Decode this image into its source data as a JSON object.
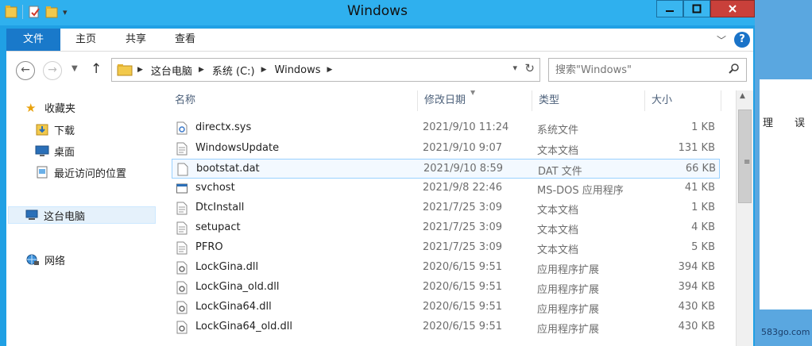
{
  "window": {
    "title": "Windows"
  },
  "ribbon": {
    "tabs": [
      "文件",
      "主页",
      "共享",
      "查看"
    ],
    "help_label": "?"
  },
  "address": {
    "crumbs": [
      "这台电脑",
      "系统 (C:)",
      "Windows"
    ]
  },
  "search": {
    "placeholder": "搜索\"Windows\""
  },
  "sidebar": {
    "items": [
      {
        "label": "收藏夹",
        "icon": "star-icon"
      },
      {
        "label": "下载",
        "icon": "download-folder-icon"
      },
      {
        "label": "桌面",
        "icon": "desktop-icon"
      },
      {
        "label": "最近访问的位置",
        "icon": "recent-places-icon"
      },
      {
        "label": "这台电脑",
        "icon": "computer-icon"
      },
      {
        "label": "网络",
        "icon": "network-icon"
      }
    ]
  },
  "columns": [
    "名称",
    "修改日期",
    "类型",
    "大小"
  ],
  "files": [
    {
      "name": "directx.sys",
      "date": "2021/9/10 11:24",
      "type": "系统文件",
      "size": "1 KB",
      "icon": "system-file-icon"
    },
    {
      "name": "WindowsUpdate",
      "date": "2021/9/10 9:07",
      "type": "文本文档",
      "size": "131 KB",
      "icon": "text-file-icon"
    },
    {
      "name": "bootstat.dat",
      "date": "2021/9/10 8:59",
      "type": "DAT 文件",
      "size": "66 KB",
      "icon": "blank-file-icon"
    },
    {
      "name": "svchost",
      "date": "2021/9/8 22:46",
      "type": "MS-DOS 应用程序",
      "size": "41 KB",
      "icon": "msdos-app-icon"
    },
    {
      "name": "DtcInstall",
      "date": "2021/7/25 3:09",
      "type": "文本文档",
      "size": "1 KB",
      "icon": "text-file-icon"
    },
    {
      "name": "setupact",
      "date": "2021/7/25 3:09",
      "type": "文本文档",
      "size": "4 KB",
      "icon": "text-file-icon"
    },
    {
      "name": "PFRO",
      "date": "2021/7/25 3:09",
      "type": "文本文档",
      "size": "5 KB",
      "icon": "text-file-icon"
    },
    {
      "name": "LockGina.dll",
      "date": "2020/6/15 9:51",
      "type": "应用程序扩展",
      "size": "394 KB",
      "icon": "dll-file-icon"
    },
    {
      "name": "LockGina_old.dll",
      "date": "2020/6/15 9:51",
      "type": "应用程序扩展",
      "size": "394 KB",
      "icon": "dll-file-icon"
    },
    {
      "name": "LockGina64.dll",
      "date": "2020/6/15 9:51",
      "type": "应用程序扩展",
      "size": "430 KB",
      "icon": "dll-file-icon"
    },
    {
      "name": "LockGina64_old.dll",
      "date": "2020/6/15 9:51",
      "type": "应用程序扩展",
      "size": "430 KB",
      "icon": "dll-file-icon"
    }
  ],
  "background": {
    "cells": [
      "理",
      "误"
    ],
    "watermark": "583go.com"
  },
  "colors": {
    "title_bar": "#2fb0ee",
    "file_tab": "#1979ca",
    "close_button": "#c9403a",
    "selection": "#f3f9ff"
  }
}
